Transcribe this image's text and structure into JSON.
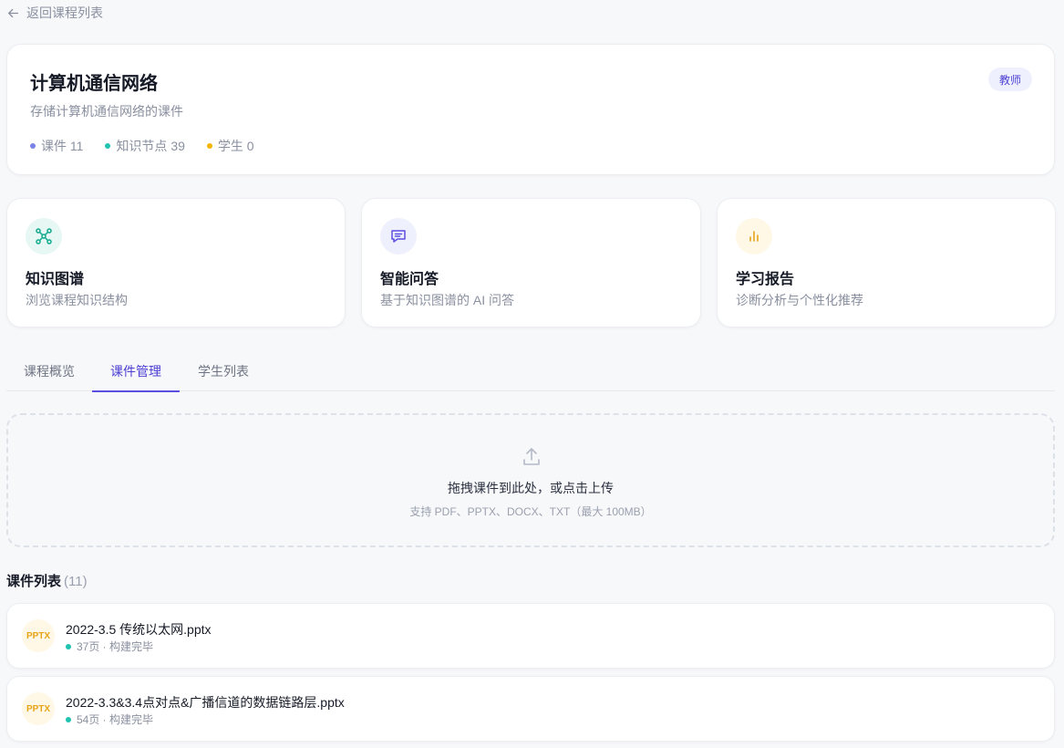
{
  "nav": {
    "back_label": "返回课程列表"
  },
  "course": {
    "title": "计算机通信网络",
    "description": "存储计算机通信网络的课件",
    "role_badge": "教师",
    "stats": [
      {
        "label": "课件 11",
        "color": "#7c83e6"
      },
      {
        "label": "知识节点 39",
        "color": "#1fc3b0"
      },
      {
        "label": "学生 0",
        "color": "#f5b400"
      }
    ]
  },
  "features": [
    {
      "title": "知识图谱",
      "desc": "浏览课程知识结构",
      "icon": "graph-icon",
      "color": "#13a98f",
      "bg": "#e7f8f4"
    },
    {
      "title": "智能问答",
      "desc": "基于知识图谱的 AI 问答",
      "icon": "chat-icon",
      "color": "#5b4ee0",
      "bg": "#eef0fd"
    },
    {
      "title": "学习报告",
      "desc": "诊断分析与个性化推荐",
      "icon": "bar-chart-icon",
      "color": "#e8a317",
      "bg": "#fff8e6"
    }
  ],
  "tabs": [
    {
      "label": "课程概览",
      "active": false
    },
    {
      "label": "课件管理",
      "active": true
    },
    {
      "label": "学生列表",
      "active": false
    }
  ],
  "upload": {
    "title": "拖拽课件到此处，或点击上传",
    "hint": "支持 PDF、PPTX、DOCX、TXT（最大 100MB）"
  },
  "file_list": {
    "title": "课件列表",
    "count": "(11)",
    "items": [
      {
        "type": "PPTX",
        "name": "2022-3.5 传统以太网.pptx",
        "meta": "37页 · 构建完毕",
        "status_color": "#1fc3b0"
      },
      {
        "type": "PPTX",
        "name": "2022-3.3&3.4点对点&广播信道的数据链路层.pptx",
        "meta": "54页 · 构建完毕",
        "status_color": "#1fc3b0"
      }
    ]
  }
}
